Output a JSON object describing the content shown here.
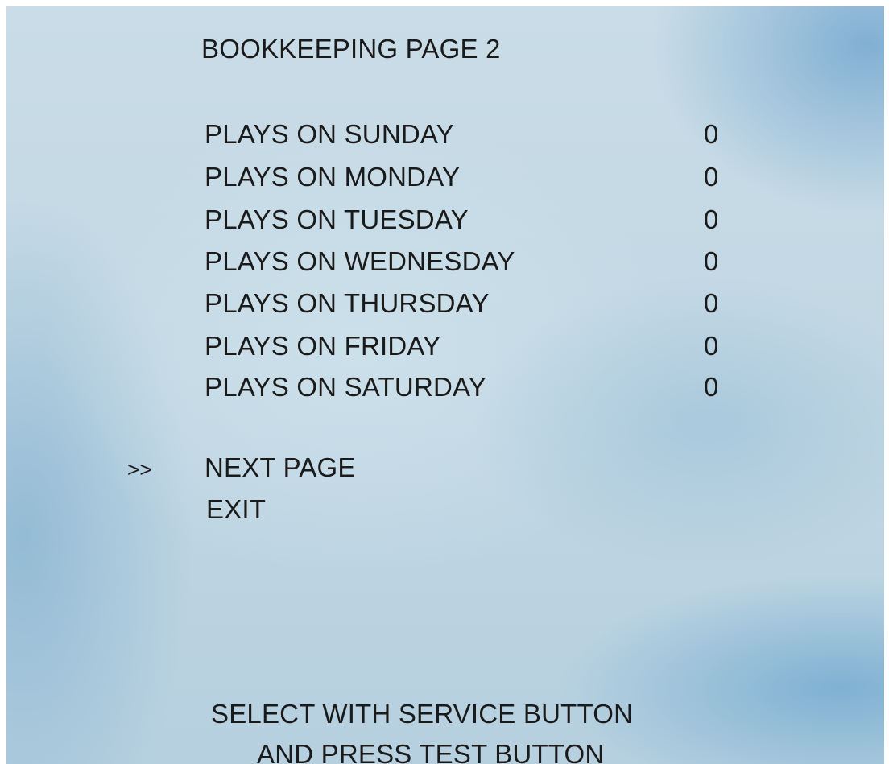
{
  "title": "BOOKKEEPING PAGE 2",
  "rows": [
    {
      "label": "PLAYS ON SUNDAY",
      "value": "0"
    },
    {
      "label": "PLAYS ON MONDAY",
      "value": "0"
    },
    {
      "label": "PLAYS ON TUESDAY",
      "value": "0"
    },
    {
      "label": "PLAYS ON WEDNESDAY",
      "value": "0"
    },
    {
      "label": "PLAYS ON THURSDAY",
      "value": "0"
    },
    {
      "label": "PLAYS ON FRIDAY",
      "value": "0"
    },
    {
      "label": "PLAYS ON SATURDAY",
      "value": "0"
    }
  ],
  "menu": {
    "cursor": ">>",
    "next_page": "NEXT PAGE",
    "exit": "EXIT"
  },
  "footer": {
    "line1": "SELECT WITH SERVICE BUTTON",
    "line2": "AND PRESS TEST BUTTON"
  }
}
